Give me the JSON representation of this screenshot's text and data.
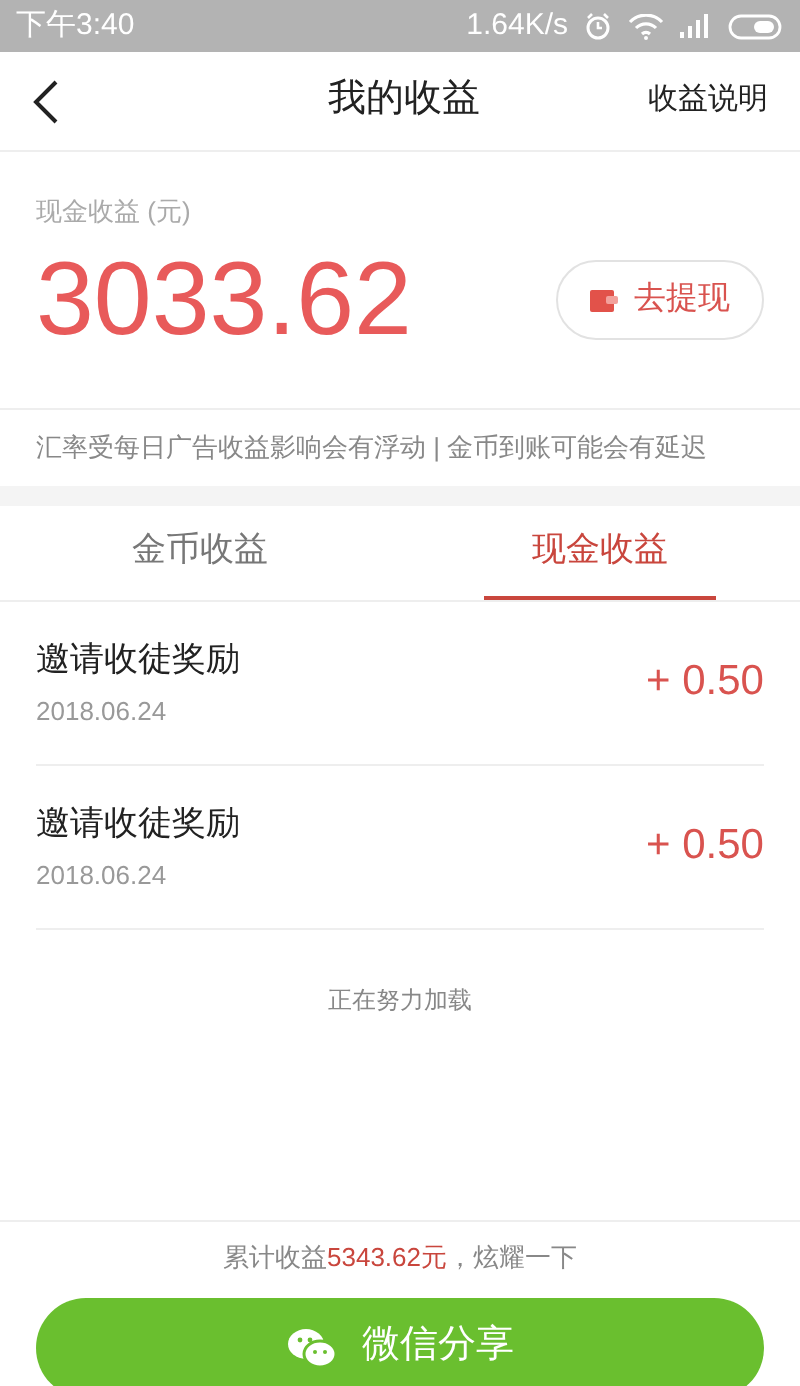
{
  "status_bar": {
    "time": "下午3:40",
    "speed": "1.64K/s"
  },
  "header": {
    "title": "我的收益",
    "action": "收益说明"
  },
  "balance": {
    "label": "现金收益 (元)",
    "amount": "3033.62",
    "withdraw_button": "去提现"
  },
  "notice": "汇率受每日广告收益影响会有浮动 | 金币到账可能会有延迟",
  "tabs": [
    {
      "label": "金币收益",
      "selected": false
    },
    {
      "label": "现金收益",
      "selected": true
    }
  ],
  "records": [
    {
      "title": "邀请收徒奖励",
      "date": "2018.06.24",
      "amount": "+ 0.50"
    },
    {
      "title": "邀请收徒奖励",
      "date": "2018.06.24",
      "amount": "+ 0.50"
    }
  ],
  "loading": "正在努力加载",
  "footer": {
    "summary_prefix": "累计收益",
    "summary_highlight": "5343.62元",
    "summary_suffix": "，炫耀一下",
    "share_button": "微信分享"
  }
}
